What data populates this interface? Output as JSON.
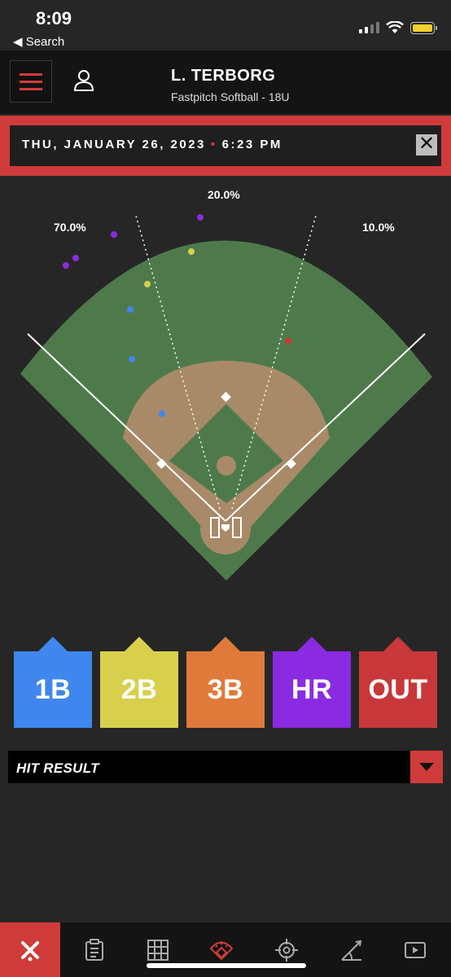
{
  "status": {
    "time": "8:09",
    "back_label": "◀ Search"
  },
  "header": {
    "player_name": "L. TERBORG",
    "league": "Fastpitch Softball - 18U"
  },
  "session": {
    "date": "THU, JANUARY 26, 2023",
    "separator": "•",
    "time": "6:23 PM",
    "close_label": "✕"
  },
  "spray": {
    "left_pct": "70.0%",
    "center_pct": "20.0%",
    "right_pct": "10.0%"
  },
  "results": [
    {
      "label": "1B",
      "color": "#3f86ee"
    },
    {
      "label": "2B",
      "color": "#d8d04d"
    },
    {
      "label": "3B",
      "color": "#e07a3a"
    },
    {
      "label": "HR",
      "color": "#8a2be2"
    },
    {
      "label": "OUT",
      "color": "#c8383a"
    }
  ],
  "hit_result": {
    "label": "HIT RESULT"
  },
  "colors": {
    "accent": "#cf3b3b",
    "field_grass": "#4e7a4b",
    "infield_dirt": "#a88a68",
    "background": "#262626"
  },
  "nav": [
    "bats-icon",
    "clipboard-icon",
    "grid-icon",
    "field-icon",
    "target-icon",
    "angle-icon",
    "video-icon"
  ]
}
